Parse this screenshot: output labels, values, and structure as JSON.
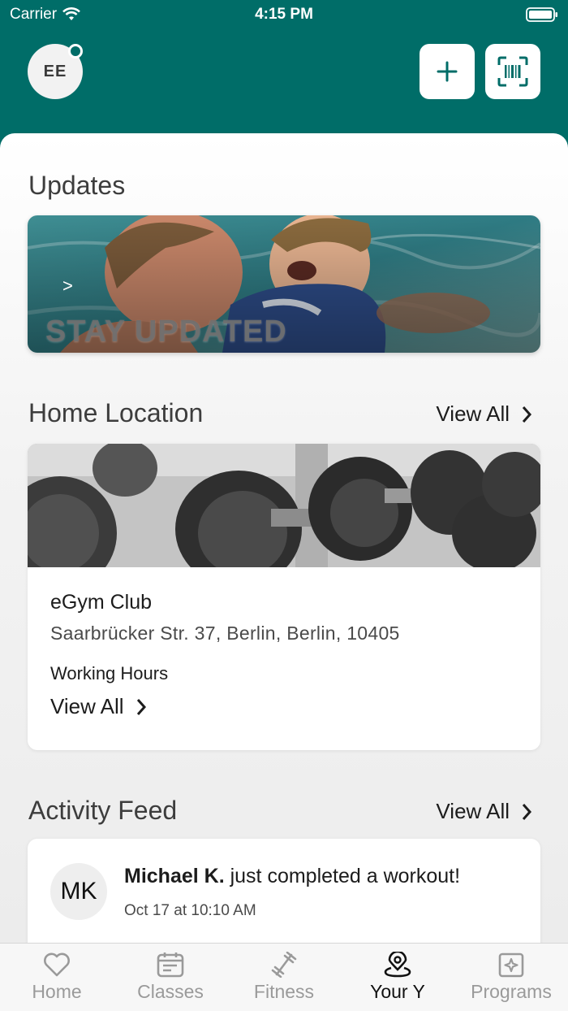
{
  "status_bar": {
    "carrier": "Carrier",
    "time": "4:15 PM"
  },
  "header": {
    "avatar_initials": "EE"
  },
  "updates": {
    "title": "Updates",
    "banner_text": "STAY UPDATED",
    "banner_arrow": ">"
  },
  "home_location": {
    "title": "Home Location",
    "view_all": "View All",
    "club_name": "eGym Club",
    "address": "Saarbrücker Str. 37, Berlin, Berlin, 10405",
    "working_hours_label": "Working Hours",
    "working_hours_view_all": "View All"
  },
  "activity_feed": {
    "title": "Activity Feed",
    "view_all": "View All",
    "items": [
      {
        "initials": "MK",
        "name": "Michael K.",
        "action": " just completed a workout!",
        "time": "Oct 17 at 10:10 AM"
      }
    ]
  },
  "tabs": [
    {
      "label": "Home",
      "icon": "heart-icon"
    },
    {
      "label": "Classes",
      "icon": "calendar-icon"
    },
    {
      "label": "Fitness",
      "icon": "dumbbell-icon"
    },
    {
      "label": "Your Y",
      "icon": "location-pin-icon",
      "active": true
    },
    {
      "label": "Programs",
      "icon": "programs-icon"
    }
  ],
  "colors": {
    "brand": "#006d68",
    "active_tab": "#111111",
    "inactive_tab": "#9a9a9a"
  }
}
